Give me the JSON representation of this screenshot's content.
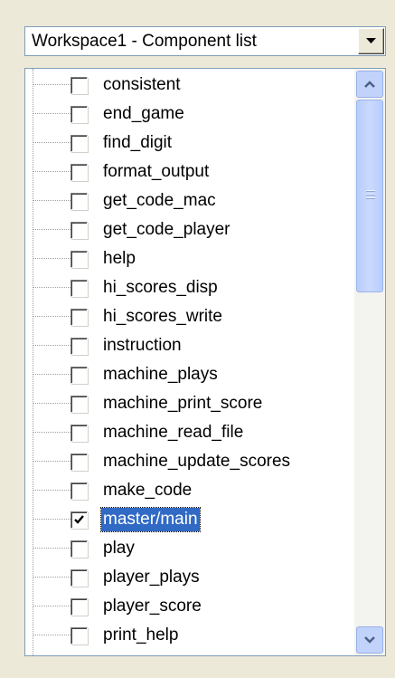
{
  "combo": {
    "selected": "Workspace1 - Component list",
    "dropdown_icon": "chevron-down-icon"
  },
  "components": [
    {
      "label": "consistent",
      "checked": false
    },
    {
      "label": "end_game",
      "checked": false
    },
    {
      "label": "find_digit",
      "checked": false
    },
    {
      "label": "format_output",
      "checked": false
    },
    {
      "label": "get_code_mac",
      "checked": false
    },
    {
      "label": "get_code_player",
      "checked": false
    },
    {
      "label": "help",
      "checked": false
    },
    {
      "label": "hi_scores_disp",
      "checked": false
    },
    {
      "label": "hi_scores_write",
      "checked": false
    },
    {
      "label": "instruction",
      "checked": false
    },
    {
      "label": "machine_plays",
      "checked": false
    },
    {
      "label": "machine_print_score",
      "checked": false
    },
    {
      "label": "machine_read_file",
      "checked": false
    },
    {
      "label": "machine_update_scores",
      "checked": false
    },
    {
      "label": "make_code",
      "checked": false
    },
    {
      "label": "master/main",
      "checked": true,
      "selected": true
    },
    {
      "label": "play",
      "checked": false
    },
    {
      "label": "player_plays",
      "checked": false
    },
    {
      "label": "player_score",
      "checked": false
    },
    {
      "label": "print_help",
      "checked": false
    }
  ],
  "colors": {
    "selection": "#316ac5",
    "panel": "#ece9d8"
  }
}
